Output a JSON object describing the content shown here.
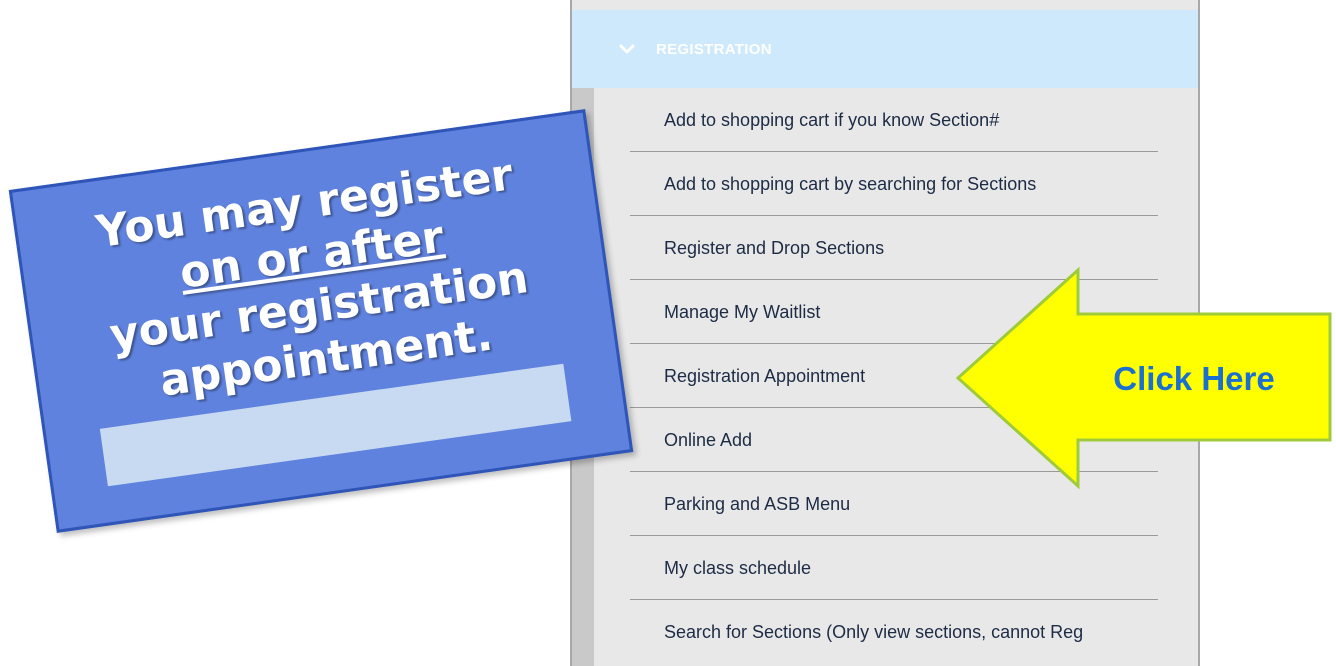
{
  "menu": {
    "header": "REGISTRATION",
    "items": [
      {
        "label": "Add to shopping cart if you know Section#"
      },
      {
        "label": "Add to shopping cart by searching for Sections"
      },
      {
        "label": "Register and Drop Sections"
      },
      {
        "label": "Manage My Waitlist"
      },
      {
        "label": "Registration Appointment"
      },
      {
        "label": "Online Add"
      },
      {
        "label": "Parking and ASB Menu"
      },
      {
        "label": "My class schedule"
      },
      {
        "label": "Search for Sections (Only view sections, cannot Reg"
      }
    ]
  },
  "note": {
    "line1": "You may register",
    "line2": "on or after",
    "line3": "your registration",
    "line4": "appointment."
  },
  "callout": {
    "label": "Click Here",
    "fill_color": "#ffff00",
    "text_color": "#1a6fd0"
  }
}
